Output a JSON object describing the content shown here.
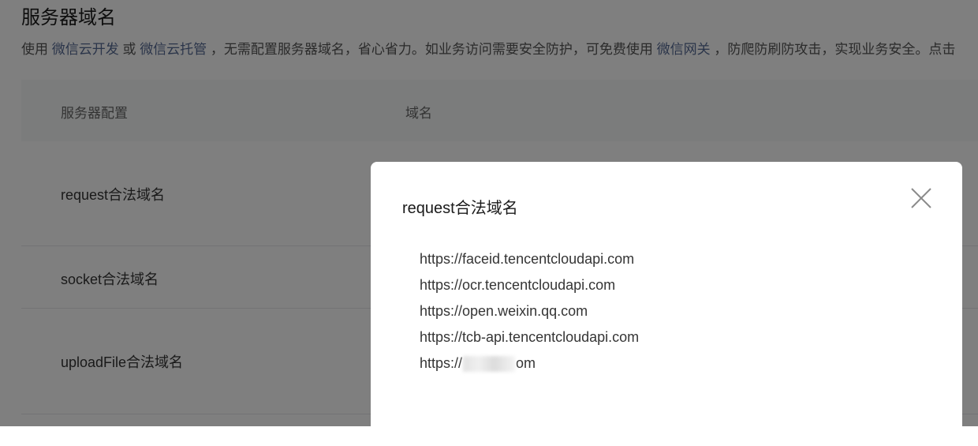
{
  "page": {
    "title": "服务器域名",
    "description": {
      "t1": "使用 ",
      "link1": "微信云开发",
      "t2": " 或 ",
      "link2": "微信云托管",
      "t3": " ，无需配置服务器域名，省心省力。如业务访问需要安全防护，可免费使用 ",
      "link3": "微信网关",
      "t4": " ，防爬防刷防攻击，实现业务安全。点击"
    }
  },
  "table": {
    "headers": [
      "服务器配置",
      "域名"
    ],
    "rows": [
      "request合法域名",
      "socket合法域名",
      "uploadFile合法域名"
    ]
  },
  "dialog": {
    "title": "request合法域名",
    "domains": [
      "https://faceid.tencentcloudapi.com",
      "https://ocr.tencentcloudapi.com",
      "https://open.weixin.qq.com",
      "https://tcb-api.tencentcloudapi.com"
    ],
    "redacted_domain": {
      "prefix": "https://",
      "suffix": "om"
    }
  },
  "colors": {
    "link": "#576b95",
    "overlay": "rgba(0,0,0,0.5)"
  },
  "icons": {
    "close": "close-icon"
  }
}
